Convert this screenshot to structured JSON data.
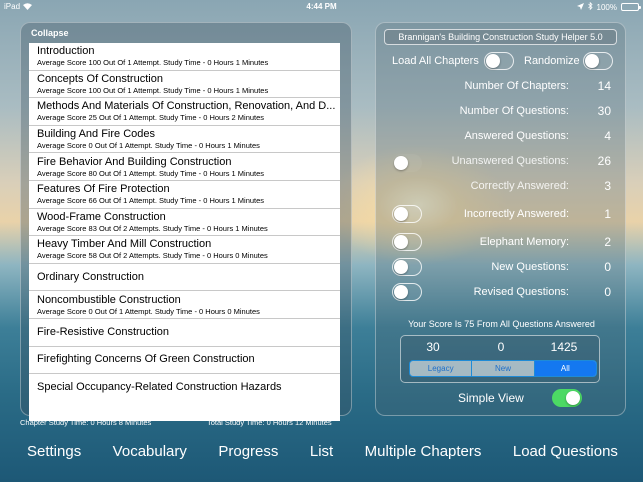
{
  "status": {
    "carrier": "iPad",
    "time": "4:44 PM",
    "battery": "100%"
  },
  "left_panel": {
    "collapse_label": "Collapse",
    "chapters": [
      {
        "title": "Introduction",
        "sub": "Average Score 100 Out Of 1 Attempt. Study Time - 0 Hours 1 Minutes"
      },
      {
        "title": "Concepts Of Construction",
        "sub": "Average Score 100 Out Of 1 Attempt. Study Time - 0 Hours 1 Minutes"
      },
      {
        "title": "Methods And Materials Of Construction, Renovation, And D...",
        "sub": "Average Score 25 Out Of 1 Attempt. Study Time - 0 Hours 2 Minutes"
      },
      {
        "title": "Building And Fire Codes",
        "sub": "Average Score 0 Out Of 1 Attempt. Study Time - 0 Hours 1 Minutes"
      },
      {
        "title": "Fire Behavior And Building Construction",
        "sub": "Average Score 80 Out Of 1 Attempt. Study Time - 0 Hours 1 Minutes"
      },
      {
        "title": "Features Of Fire Protection",
        "sub": "Average Score 66 Out Of 1 Attempt. Study Time - 0 Hours 1 Minutes"
      },
      {
        "title": "Wood-Frame Construction",
        "sub": "Average Score 83 Out Of 2 Attempts. Study Time - 0 Hours 1 Minutes"
      },
      {
        "title": "Heavy Timber And Mill Construction",
        "sub": "Average Score 58 Out Of 2 Attempts. Study Time - 0 Hours 0 Minutes"
      },
      {
        "title": "Ordinary Construction",
        "sub": ""
      },
      {
        "title": "Noncombustible Construction",
        "sub": "Average Score 0 Out Of 1 Attempt. Study Time - 0 Hours 0 Minutes"
      },
      {
        "title": "Fire-Resistive Construction",
        "sub": ""
      },
      {
        "title": "Firefighting Concerns Of Green Construction",
        "sub": ""
      },
      {
        "title": "Special Occupancy-Related Construction Hazards",
        "sub": ""
      }
    ],
    "chapter_study_time": "Chapter Study Time: 0 Hours 8 Minutes",
    "total_study_time": "Total Study Time: 0 Hours 12 Minutes"
  },
  "right_panel": {
    "title": "Brannigan's Building Construction Study Helper 5.0",
    "load_all_chapters": "Load All Chapters",
    "randomize": "Randomize",
    "stats": [
      {
        "label": "Number Of Chapters:",
        "value": "14"
      },
      {
        "label": "Number Of Questions:",
        "value": "30"
      },
      {
        "label": "Answered Questions:",
        "value": "4"
      },
      {
        "label": "Unanswered Questions:",
        "value": "26"
      },
      {
        "label": "Correctly Answered:",
        "value": "3"
      },
      {
        "label": "Incorrectly Answered:",
        "value": "1"
      },
      {
        "label": "Elephant Memory:",
        "value": "2"
      },
      {
        "label": "New Questions:",
        "value": "0"
      },
      {
        "label": "Revised Questions:",
        "value": "0"
      }
    ],
    "score_text": "Your Score Is 75 From All Questions Answered",
    "score_numbers": [
      "30",
      "0",
      "1425"
    ],
    "segments": [
      "Legacy",
      "New",
      "All"
    ],
    "active_segment": "All",
    "simple_view": "Simple View"
  },
  "bottom_bar": {
    "items": [
      "Settings",
      "Vocabulary",
      "Progress",
      "List",
      "Multiple Chapters",
      "Load Questions"
    ]
  },
  "colors": {
    "toggle_on": "#4cd964",
    "segment_active": "#1478f0"
  }
}
